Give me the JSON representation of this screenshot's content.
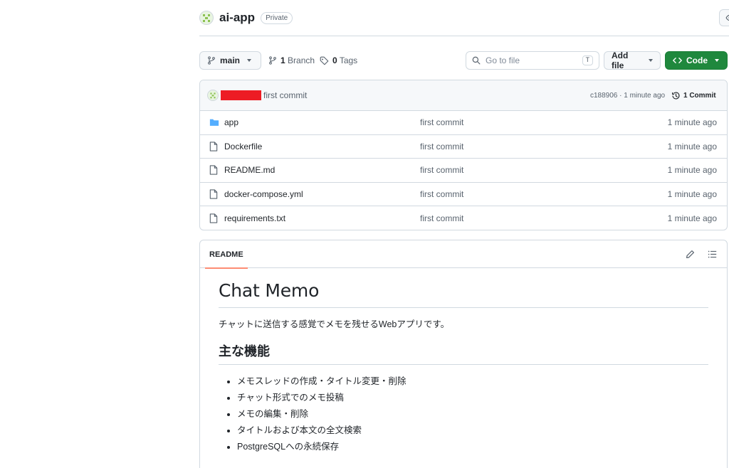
{
  "repo": {
    "name": "ai-app",
    "visibility": "Private"
  },
  "toolbar": {
    "branch": "main",
    "branches_count": "1",
    "branches_label": "Branch",
    "tags_count": "0",
    "tags_label": "Tags",
    "goto_placeholder": "Go to file",
    "goto_shortcut": "T",
    "add_file_label": "Add file",
    "code_label": "Code"
  },
  "latest_commit": {
    "message": "first commit",
    "hash_time": "c188906 · 1 minute ago",
    "commit_count": "1 Commit"
  },
  "files": [
    {
      "name": "app",
      "type": "folder",
      "commit": "first commit",
      "date": "1 minute ago"
    },
    {
      "name": "Dockerfile",
      "type": "file",
      "commit": "first commit",
      "date": "1 minute ago"
    },
    {
      "name": "README.md",
      "type": "file",
      "commit": "first commit",
      "date": "1 minute ago"
    },
    {
      "name": "docker-compose.yml",
      "type": "file",
      "commit": "first commit",
      "date": "1 minute ago"
    },
    {
      "name": "requirements.txt",
      "type": "file",
      "commit": "first commit",
      "date": "1 minute ago"
    }
  ],
  "readme": {
    "tab_label": "README",
    "title": "Chat Memo",
    "intro": "チャットに送信する感覚でメモを残せるWebアプリです。",
    "features_heading": "主な機能",
    "features": [
      "メモスレッドの作成・タイトル変更・削除",
      "チャット形式でのメモ投稿",
      "メモの編集・削除",
      "タイトルおよび本文の全文検索",
      "PostgreSQLへの永続保存"
    ]
  },
  "colors": {
    "primary_button": "#1f883d",
    "folder_icon": "#54aeff",
    "tab_underline": "#fd8c73",
    "redaction": "#ed1c24"
  }
}
